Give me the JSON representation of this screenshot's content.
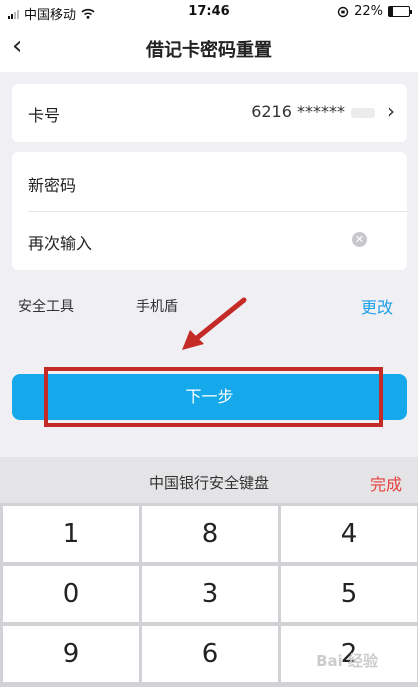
{
  "status_bar": {
    "carrier": "中国移动",
    "time": "17:46",
    "battery": "22%",
    "battery_level": 0.22
  },
  "nav": {
    "back_icon": "‹",
    "title": "借记卡密码重置"
  },
  "card_number": {
    "label": "卡号",
    "value": "6216 ******"
  },
  "password": {
    "new_label": "新密码",
    "repeat_label": "再次输入"
  },
  "security_tool": {
    "label": "安全工具",
    "value": "手机盾",
    "change": "更改"
  },
  "next_button": {
    "label": "下一步"
  },
  "keyboard": {
    "title": "中国银行安全键盘",
    "done": "完成",
    "keys": [
      "1",
      "8",
      "4",
      "0",
      "3",
      "5",
      "9",
      "6",
      "2"
    ]
  },
  "watermark": "Bai 经验",
  "colors": {
    "accent": "#15a8ea",
    "highlight": "#c42a26",
    "done": "#e8413c",
    "link": "#1ea0e6"
  }
}
